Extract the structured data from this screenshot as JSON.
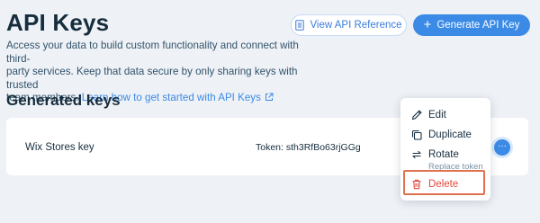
{
  "header": {
    "title": "API Keys",
    "description_line1": "Access your data to build custom functionality and connect with third-",
    "description_line2": "party services. Keep that data secure by only sharing keys with trusted",
    "description_line3": "team members. ",
    "learn_link": "Learn how to get started with API Keys",
    "view_reference_label": "View API Reference",
    "generate_label": "Generate API Key"
  },
  "section": {
    "title": "Generated keys"
  },
  "keys": [
    {
      "name": "Wix Stores key",
      "token": "Token: sth3RfBo63rjGGg"
    }
  ],
  "menu": {
    "edit": "Edit",
    "duplicate": "Duplicate",
    "rotate": "Rotate",
    "rotate_sub": "Replace token",
    "delete": "Delete"
  },
  "colors": {
    "accent": "#3b8ae6",
    "danger": "#e0483e",
    "highlight_border": "#e0714f",
    "background": "#eef1f6"
  },
  "icons": {
    "view_reference": "document-icon",
    "generate": "plus-icon",
    "learn_link": "external-link-icon",
    "more": "more-icon",
    "edit": "pencil-icon",
    "duplicate": "duplicate-icon",
    "rotate": "rotate-icon",
    "delete": "trash-icon"
  }
}
